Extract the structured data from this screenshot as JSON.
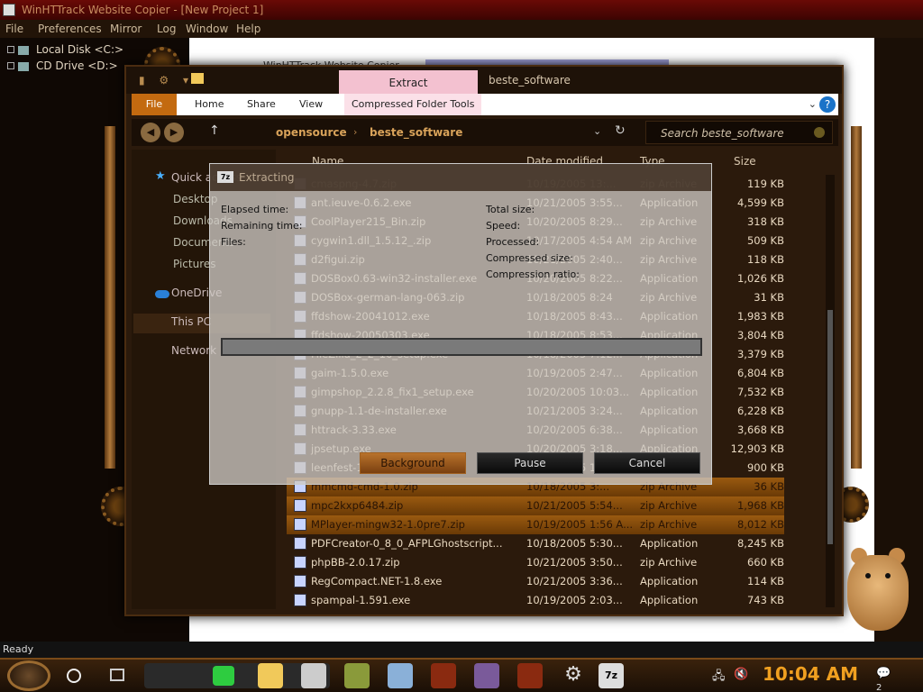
{
  "httrack": {
    "title": "WinHTTrack Website Copier - [New Project 1]",
    "menu": [
      "File",
      "Preferences",
      "Mirror",
      "Log",
      "Window",
      "Help"
    ],
    "tree": [
      "Local Disk <C:>",
      "CD Drive <D:>"
    ],
    "pane_hint": "WinHTTrack Website Copier",
    "status": "Ready"
  },
  "explorer": {
    "extract_tab": "Extract",
    "window_title": "beste_software",
    "ribbon": {
      "file": "File",
      "home": "Home",
      "share": "Share",
      "view": "View",
      "compressed": "Compressed Folder Tools"
    },
    "breadcrumb": [
      "opensource",
      "beste_software"
    ],
    "search_placeholder": "Search beste_software",
    "nav": {
      "quick_access": "Quick access",
      "desktop": "Desktop",
      "downloads": "Downloads",
      "documents": "Documents",
      "pictures": "Pictures",
      "onedrive": "OneDrive",
      "this_pc": "This PC",
      "network": "Network"
    },
    "columns": {
      "name": "Name",
      "date": "Date modified",
      "type": "Type",
      "size": "Size"
    },
    "files": [
      {
        "name": "cmaspng-4.7.zip",
        "date": "10/19/2005 13:...",
        "type": "zip Archive",
        "size": "119 KB",
        "icon": "zip-icon",
        "hl": false
      },
      {
        "name": "ant.ieuve-0.6.2.exe",
        "date": "10/21/2005 3:55...",
        "type": "Application",
        "size": "4,599 KB",
        "icon": "app-icon",
        "hl": false
      },
      {
        "name": "CoolPlayer215_Bin.zip",
        "date": "10/20/2005 8:29...",
        "type": "zip Archive",
        "size": "318 KB",
        "icon": "zip-icon",
        "hl": false
      },
      {
        "name": "cygwin1.dll_1.5.12_.zip",
        "date": "10/17/2005 4:54 AM",
        "type": "zip Archive",
        "size": "509 KB",
        "icon": "zip-icon",
        "hl": false
      },
      {
        "name": "d2figui.zip",
        "date": "10/21/2005 2:40...",
        "type": "zip Archive",
        "size": "118 KB",
        "icon": "zip-icon",
        "hl": false
      },
      {
        "name": "DOSBox0.63-win32-installer.exe",
        "date": "10/20/2005 8:22...",
        "type": "Application",
        "size": "1,026 KB",
        "icon": "app-icon",
        "hl": false
      },
      {
        "name": "DOSBox-german-lang-063.zip",
        "date": "10/18/2005 8:24",
        "type": "zip Archive",
        "size": "31 KB",
        "icon": "zip-icon",
        "hl": false
      },
      {
        "name": "ffdshow-20041012.exe",
        "date": "10/18/2005 8:43...",
        "type": "Application",
        "size": "1,983 KB",
        "icon": "app-icon",
        "hl": false
      },
      {
        "name": "ffdshow-20050303.exe",
        "date": "10/18/2005 8:53...",
        "type": "Application",
        "size": "3,804 KB",
        "icon": "app-icon",
        "hl": false
      },
      {
        "name": "FileZilla_2_2_16_setup.exe",
        "date": "10/18/2005 7:12...",
        "type": "Application",
        "size": "3,379 KB",
        "icon": "app-icon",
        "hl": false
      },
      {
        "name": "gaim-1.5.0.exe",
        "date": "10/19/2005 2:47...",
        "type": "Application",
        "size": "6,804 KB",
        "icon": "app-icon",
        "hl": false
      },
      {
        "name": "gimpshop_2.2.8_fix1_setup.exe",
        "date": "10/20/2005 10:03...",
        "type": "Application",
        "size": "7,532 KB",
        "icon": "app-icon",
        "hl": false
      },
      {
        "name": "gnupp-1.1-de-installer.exe",
        "date": "10/21/2005 3:24...",
        "type": "Application",
        "size": "6,228 KB",
        "icon": "app-icon",
        "hl": false
      },
      {
        "name": "httrack-3.33.exe",
        "date": "10/20/2005 6:38...",
        "type": "Application",
        "size": "3,668 KB",
        "icon": "app-icon",
        "hl": false
      },
      {
        "name": "jpsetup.exe",
        "date": "10/20/2005 3:18...",
        "type": "Application",
        "size": "12,903 KB",
        "icon": "app-icon",
        "hl": false
      },
      {
        "name": "leenfest-1.0.zip",
        "date": "10/18/2005 1:58 AM",
        "type": "zip Archive",
        "size": "900 KB",
        "icon": "zip-icon",
        "hl": false
      },
      {
        "name": "mmcmd-cmd-1.0.zip",
        "date": "10/18/2005 3:...",
        "type": "zip Archive",
        "size": "36 KB",
        "icon": "zip-icon",
        "hl": true
      },
      {
        "name": "mpc2kxp6484.zip",
        "date": "10/21/2005 5:54...",
        "type": "zip Archive",
        "size": "1,968 KB",
        "icon": "zip-icon",
        "hl": true
      },
      {
        "name": "MPlayer-mingw32-1.0pre7.zip",
        "date": "10/19/2005 1:56 A...",
        "type": "zip Archive",
        "size": "8,012 KB",
        "icon": "zip-icon",
        "hl": true
      },
      {
        "name": "PDFCreator-0_8_0_AFPLGhostscript...",
        "date": "10/18/2005 5:30...",
        "type": "Application",
        "size": "8,245 KB",
        "icon": "app-icon",
        "hl": false
      },
      {
        "name": "phpBB-2.0.17.zip",
        "date": "10/21/2005 3:50...",
        "type": "zip Archive",
        "size": "660 KB",
        "icon": "zip-icon",
        "hl": false
      },
      {
        "name": "RegCompact.NET-1.8.exe",
        "date": "10/21/2005 3:36...",
        "type": "Application",
        "size": "114 KB",
        "icon": "app-icon",
        "hl": false
      },
      {
        "name": "spampal-1.591.exe",
        "date": "10/19/2005 2:03...",
        "type": "Application",
        "size": "743 KB",
        "icon": "app-icon",
        "hl": false
      }
    ]
  },
  "dialog": {
    "icon": "7z",
    "title": "Extracting",
    "elapsed": "Elapsed time:",
    "remaining": "Remaining time:",
    "files": "Files:",
    "total_size": "Total size:",
    "speed": "Speed:",
    "processed": "Processed:",
    "compressed_size": "Compressed size:",
    "ratio": "Compression ratio:",
    "progress": 0,
    "btn_background": "Background",
    "btn_pause": "Pause",
    "btn_cancel": "Cancel"
  },
  "taskbar": {
    "time": "10:04 AM",
    "notifications": "2"
  },
  "colors": {
    "accent": "#c36a10",
    "highlight_row": "#9a5a10",
    "clock": "#f0a020"
  }
}
